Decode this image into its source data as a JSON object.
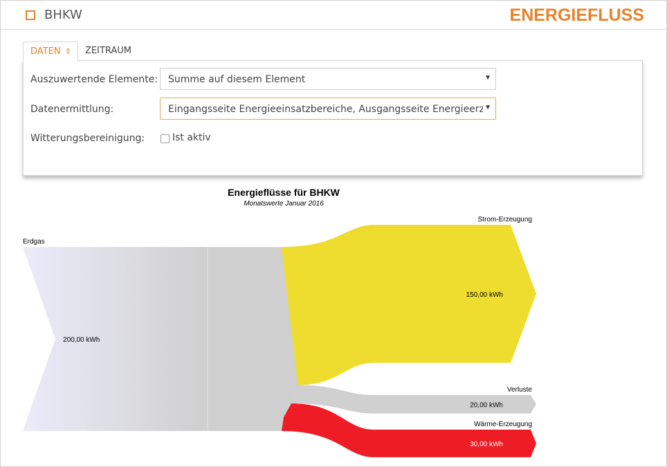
{
  "header": {
    "title": "BHKW",
    "brand": "ENERGIEFLUSS"
  },
  "tabs": [
    {
      "label": "DATEN",
      "active": true
    },
    {
      "label": "ZEITRAUM",
      "active": false
    }
  ],
  "form": {
    "elements_label": "Auszuwertende Elemente:",
    "elements_value": "Summe auf diesem Element",
    "ermittlung_label": "Datenermittlung:",
    "ermittlung_value": "Eingangsseite Energieeinsatzbereiche, Ausgangsseite Energieerzeugung",
    "witterung_label": "Witterungsbereinigung:",
    "witterung_checkbox_label": "Ist aktiv",
    "witterung_checked": false
  },
  "colors": {
    "accent": "#e8822a",
    "strom": "#eedc2e",
    "verluste": "#d0d0d0",
    "waerme": "#ee1c25",
    "erdgas_start": "#ebebfa",
    "erdgas_end": "#cfcfcf"
  },
  "chart_data": {
    "type": "sankey",
    "title": "Energieflüsse für BHKW",
    "subtitle": "Monatswerte Januar 2016",
    "unit": "kWh",
    "source": {
      "name": "Erdgas",
      "value": 200,
      "label": "200,00 kWh"
    },
    "targets": [
      {
        "name": "Strom-Erzeugung",
        "value": 150,
        "label": "150,00 kWh",
        "color": "#eedc2e"
      },
      {
        "name": "Verluste",
        "value": 20,
        "label": "20,00 kWh",
        "color": "#d0d0d0"
      },
      {
        "name": "Wärme-Erzeugung",
        "value": 30,
        "label": "30,00 kWh",
        "color": "#ee1c25"
      }
    ]
  }
}
